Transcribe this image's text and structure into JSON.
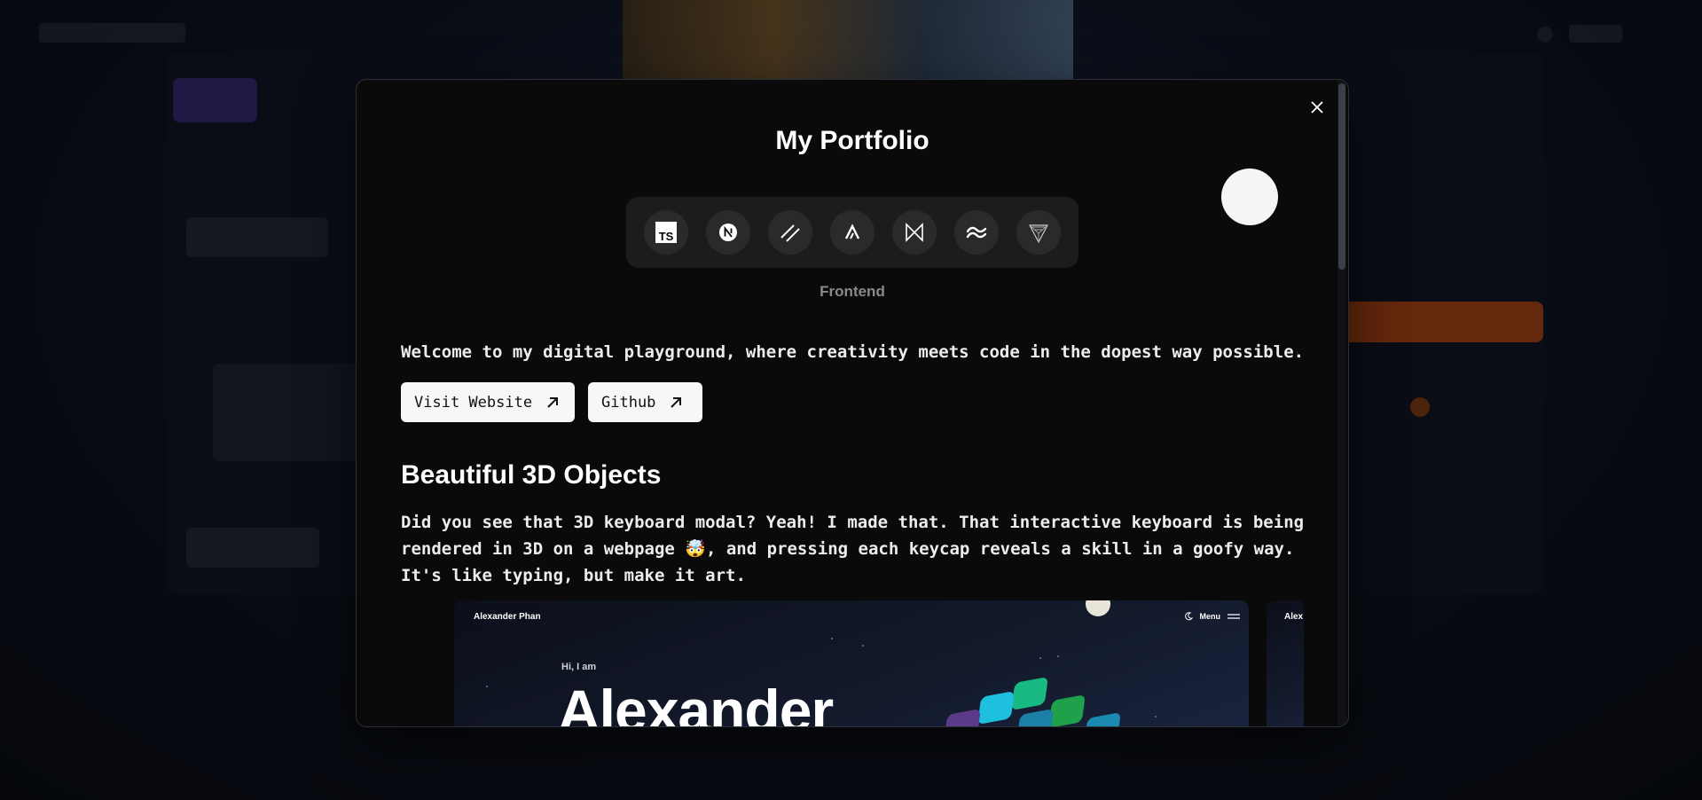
{
  "modal": {
    "title": "My Portfolio",
    "category": "Frontend",
    "tech_icons": [
      {
        "name": "typescript-icon",
        "label": "TS"
      },
      {
        "name": "nextjs-icon",
        "label": "N"
      },
      {
        "name": "shadcn-icon"
      },
      {
        "name": "aceternity-icon"
      },
      {
        "name": "framer-motion-icon"
      },
      {
        "name": "tailwind-icon"
      },
      {
        "name": "spline-icon"
      }
    ],
    "intro": "Welcome to my digital playground, where creativity meets code in the dopest way possible.",
    "buttons": {
      "visit": "Visit Website",
      "github": "Github"
    },
    "section_heading": "Beautiful 3D Objects",
    "section_body": "Did you see that 3D keyboard modal? Yeah! I made that. That interactive keyboard is being rendered in 3D on a webpage 🤯, and pressing each keycap reveals a skill in a goofy way. It's like typing, but make it art.",
    "preview": {
      "brand": "Alexander Phan",
      "menu": "Menu",
      "greeting": "Hi, I am",
      "name": "Alexander",
      "next_brand": "Alex"
    }
  },
  "colors": {
    "modal_bg": "#0a0a0a",
    "button_bg": "#f7f7f7",
    "icon_bg": "#2a2a2a",
    "tech_bar_bg": "#1c1c1c"
  }
}
